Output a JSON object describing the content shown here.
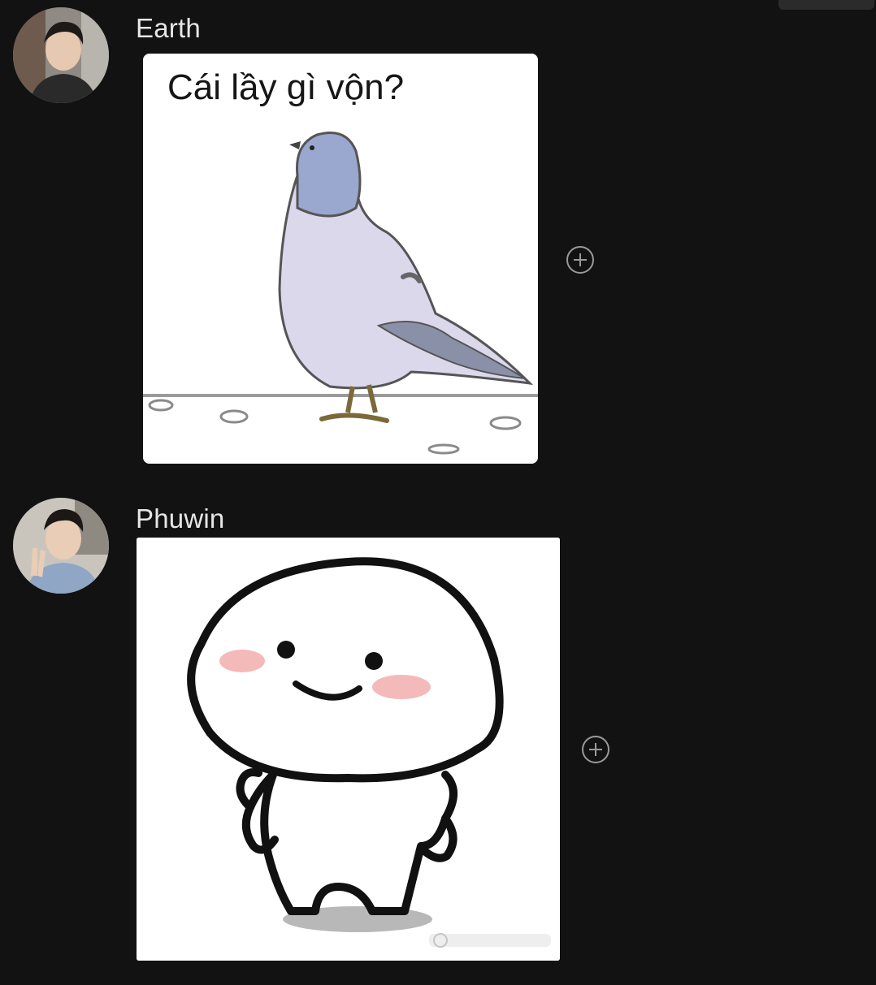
{
  "messages": [
    {
      "sender": "Earth",
      "avatar_icon": "user-avatar-earth",
      "sticker": {
        "kind": "pigeon-meme",
        "caption": "Cái lầy gì vộn?"
      },
      "reaction_icon": "add-reaction-icon"
    },
    {
      "sender": "Phuwin",
      "avatar_icon": "user-avatar-phuwin",
      "sticker": {
        "kind": "smiling-blob-character"
      },
      "reaction_icon": "add-reaction-icon"
    }
  ],
  "colors": {
    "background": "#121212",
    "name_text": "#e6e6e6",
    "icon_gray": "#9a9a9a",
    "sticker_bg": "#ffffff"
  }
}
